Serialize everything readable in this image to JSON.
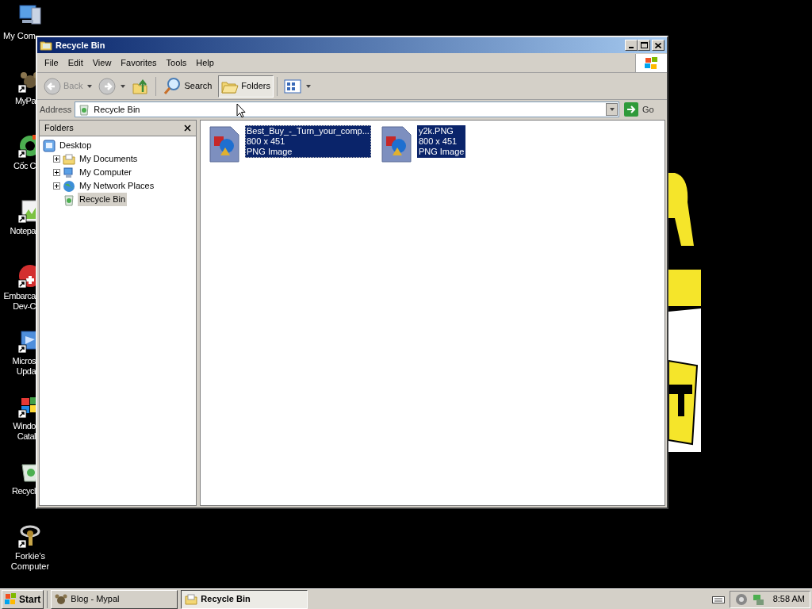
{
  "desktop_icons": [
    {
      "label": "My Com",
      "kind": "computer",
      "shortcut": false
    },
    {
      "label": "MyPa",
      "kind": "paw",
      "shortcut": true
    },
    {
      "label": "Cốc C",
      "kind": "ring",
      "shortcut": true
    },
    {
      "label": "Notepa",
      "kind": "notepad",
      "shortcut": true
    },
    {
      "label": "Embarca Dev-C",
      "kind": "devcpp",
      "shortcut": true
    },
    {
      "label": "Micros Upda",
      "kind": "update",
      "shortcut": true
    },
    {
      "label": "Windo Catal",
      "kind": "catalog",
      "shortcut": true
    },
    {
      "label": "Recycl",
      "kind": "recycle",
      "shortcut": false
    },
    {
      "label": "Forkie's Computer",
      "kind": "keys",
      "shortcut": true
    }
  ],
  "window": {
    "title": "Recycle Bin",
    "menu": [
      "File",
      "Edit",
      "View",
      "Favorites",
      "Tools",
      "Help"
    ],
    "toolbar": [
      {
        "kind": "back",
        "label": "Back",
        "disabled": true,
        "selected": false
      },
      {
        "kind": "forward",
        "disabled": true,
        "selected": false
      },
      {
        "kind": "up",
        "disabled": false,
        "selected": false
      },
      {
        "kind": "search",
        "label": "Search",
        "disabled": false,
        "selected": false
      },
      {
        "kind": "folders",
        "label": "Folders",
        "disabled": false,
        "selected": true
      },
      {
        "kind": "views",
        "selected": false
      }
    ],
    "address": {
      "label": "Address",
      "value": "Recycle Bin",
      "go": "Go"
    },
    "folders_pane": {
      "title": "Folders",
      "tree": [
        {
          "label": "Desktop",
          "kind": "desktop",
          "selected": false,
          "children": [
            {
              "label": "My Documents",
              "kind": "documents",
              "expandable": true,
              "selected": false
            },
            {
              "label": "My Computer",
              "kind": "computer",
              "expandable": true,
              "selected": false
            },
            {
              "label": "My Network Places",
              "kind": "network",
              "expandable": true,
              "selected": false
            },
            {
              "label": "Recycle Bin",
              "kind": "recycle",
              "expandable": false,
              "selected": true
            }
          ]
        }
      ]
    },
    "files": [
      {
        "name": "Best_Buy_-_Turn_your_comp...",
        "dimensions": "800 x 451",
        "type": "PNG Image",
        "selected": true,
        "focused": true
      },
      {
        "name": "y2k.PNG",
        "dimensions": "800 x 451",
        "type": "PNG Image",
        "selected": true,
        "focused": false
      }
    ]
  },
  "taskbar": {
    "start": "Start",
    "tasks": [
      {
        "label": "Blog - Mypal",
        "kind": "paw",
        "selected": false
      },
      {
        "label": "Recycle Bin",
        "kind": "folder",
        "selected": true
      }
    ],
    "clock": "8:58 AM"
  }
}
